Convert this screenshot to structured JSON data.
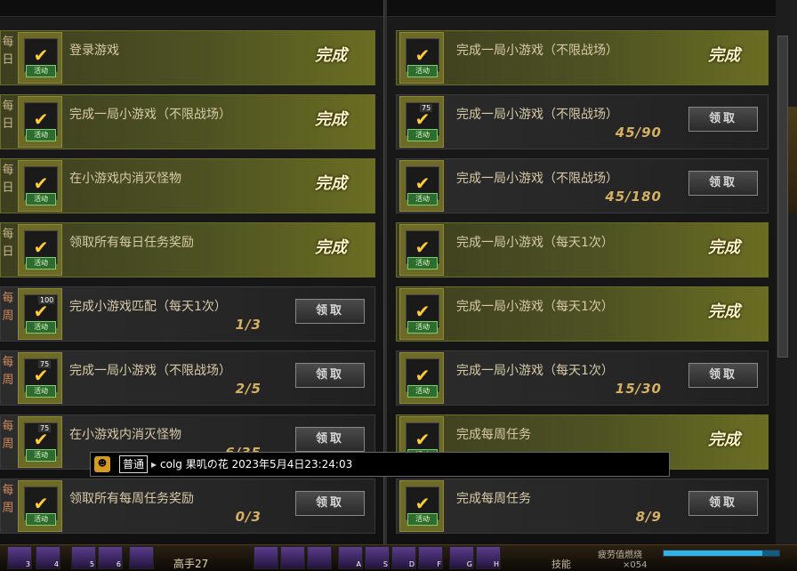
{
  "labels": {
    "daily": "每\n日",
    "weekly": "每\n周",
    "done": "完成",
    "claim": "领取",
    "badge": "活动"
  },
  "left_tasks": [
    {
      "tag": "daily",
      "title": "登录游戏",
      "status": "done",
      "num": ""
    },
    {
      "tag": "daily",
      "title": "完成一局小游戏（不限战场）",
      "status": "done",
      "num": ""
    },
    {
      "tag": "daily",
      "title": "在小游戏内消灭怪物",
      "status": "done",
      "num": ""
    },
    {
      "tag": "daily",
      "title": "领取所有每日任务奖励",
      "status": "done",
      "num": ""
    },
    {
      "tag": "weekly",
      "title": "完成小游戏匹配（每天1次）",
      "status": "claim",
      "progress": "1/3",
      "num": "100"
    },
    {
      "tag": "weekly",
      "title": "完成一局小游戏（不限战场）",
      "status": "claim",
      "progress": "2/5",
      "num": "75"
    },
    {
      "tag": "weekly",
      "title": "在小游戏内消灭怪物",
      "status": "claim",
      "progress": "6/35",
      "num": "75"
    },
    {
      "tag": "weekly",
      "title": "领取所有每周任务奖励",
      "status": "claim",
      "progress": "0/3",
      "num": ""
    }
  ],
  "right_tasks": [
    {
      "title": "完成一局小游戏（不限战场）",
      "status": "done",
      "num": ""
    },
    {
      "title": "完成一局小游戏（不限战场）",
      "status": "claim",
      "progress": "45/90",
      "num": "75"
    },
    {
      "title": "完成一局小游戏（不限战场）",
      "status": "claim",
      "progress": "45/180",
      "num": ""
    },
    {
      "title": "完成一局小游戏（每天1次）",
      "status": "done",
      "num": ""
    },
    {
      "title": "完成一局小游戏（每天1次）",
      "status": "done",
      "num": ""
    },
    {
      "title": "完成一局小游戏（每天1次）",
      "status": "claim",
      "progress": "15/30",
      "num": ""
    },
    {
      "title": "完成每周任务",
      "status": "done",
      "num": ""
    },
    {
      "title": "完成每周任务",
      "status": "claim",
      "progress": "8/9",
      "num": ""
    }
  ],
  "chat": {
    "channel": "普通",
    "text": "colg 果叽の花 2023年5月4日23:24:03"
  },
  "hud": {
    "level": "高手27",
    "skill_label": "技能",
    "fatigue_label": "疲劳值燃烧",
    "fatigue_fraction": 0.85,
    "count": "×054",
    "slot_keys": [
      "3",
      "4",
      "5",
      "6",
      "",
      "",
      "",
      "",
      "A",
      "S",
      "D",
      "F",
      "G",
      "H"
    ]
  },
  "colors": {
    "done_bar": "#4e5222",
    "claim_bar": "#262626",
    "progress": "#d5b062"
  }
}
